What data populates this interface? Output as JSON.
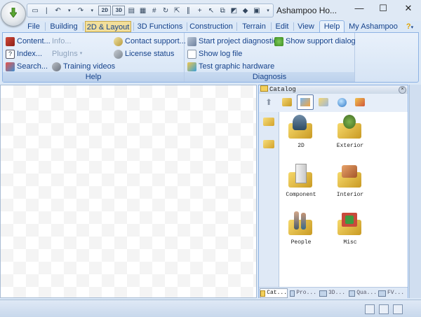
{
  "window": {
    "title": "Ashampoo Ho...",
    "controls": {
      "minimize": "—",
      "maximize": "☐",
      "close": "✕"
    }
  },
  "quick_access": [
    "2D",
    "3D"
  ],
  "tabs": [
    {
      "label": "File"
    },
    {
      "label": "Building"
    },
    {
      "label": "2D & Layout"
    },
    {
      "label": "3D Functions"
    },
    {
      "label": "Construction"
    },
    {
      "label": "Terrain"
    },
    {
      "label": "Edit"
    },
    {
      "label": "View"
    },
    {
      "label": "Help"
    },
    {
      "label": "My Ashampoo"
    }
  ],
  "active_tab": "Help",
  "ribbon": {
    "help_group": {
      "label": "Help",
      "items": [
        {
          "label": "Content...",
          "icon": "book-icon"
        },
        {
          "label": "Info...",
          "icon": "info-icon",
          "disabled": true
        },
        {
          "label": "Contact support...",
          "icon": "support-icon"
        },
        {
          "label": "Index...",
          "icon": "question-icon"
        },
        {
          "label": "PlugIns",
          "icon": "plugin-icon",
          "disabled": true
        },
        {
          "label": "License status",
          "icon": "license-icon"
        },
        {
          "label": "Search...",
          "icon": "search-icon"
        },
        {
          "label": "Training videos",
          "icon": "video-icon"
        }
      ]
    },
    "diagnosis_group": {
      "label": "Diagnosis",
      "items": [
        {
          "label": "Start project diagnostic",
          "icon": "diagnostic-icon"
        },
        {
          "label": "Show support dialog",
          "icon": "support-dialog-icon"
        },
        {
          "label": "Show log file",
          "icon": "log-icon"
        },
        {
          "label": "Test graphic hardware",
          "icon": "hardware-icon"
        }
      ]
    }
  },
  "catalog": {
    "title": "Catalog",
    "items": [
      {
        "label": "2D"
      },
      {
        "label": "Exterior"
      },
      {
        "label": "Component"
      },
      {
        "label": "Interior"
      },
      {
        "label": "People"
      },
      {
        "label": "Misc"
      }
    ],
    "bottom_tabs": [
      {
        "label": "Cat..."
      },
      {
        "label": "Pro..."
      },
      {
        "label": "3D..."
      },
      {
        "label": "Qua..."
      },
      {
        "label": "FV..."
      }
    ]
  },
  "colors": {
    "accent": "#15428b",
    "ribbon_bg": "#dbe8f7",
    "border": "#8db2e3"
  }
}
